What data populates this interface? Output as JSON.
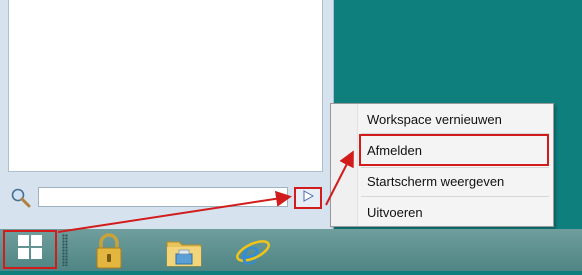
{
  "context_menu": {
    "items": [
      {
        "label": "Workspace vernieuwen"
      },
      {
        "label": "Afmelden"
      },
      {
        "label": "Startscherm weergeven"
      },
      {
        "label": "Uitvoeren"
      }
    ]
  },
  "search": {
    "value": "",
    "placeholder": ""
  },
  "taskbar": {
    "icons": [
      "start-windows-icon",
      "lock-icon",
      "file-explorer-icon",
      "internet-explorer-icon"
    ]
  },
  "colors": {
    "highlight_red": "#d21c1c",
    "desktop_teal": "#0f7f7e",
    "taskbar": "#5b8f8e"
  }
}
